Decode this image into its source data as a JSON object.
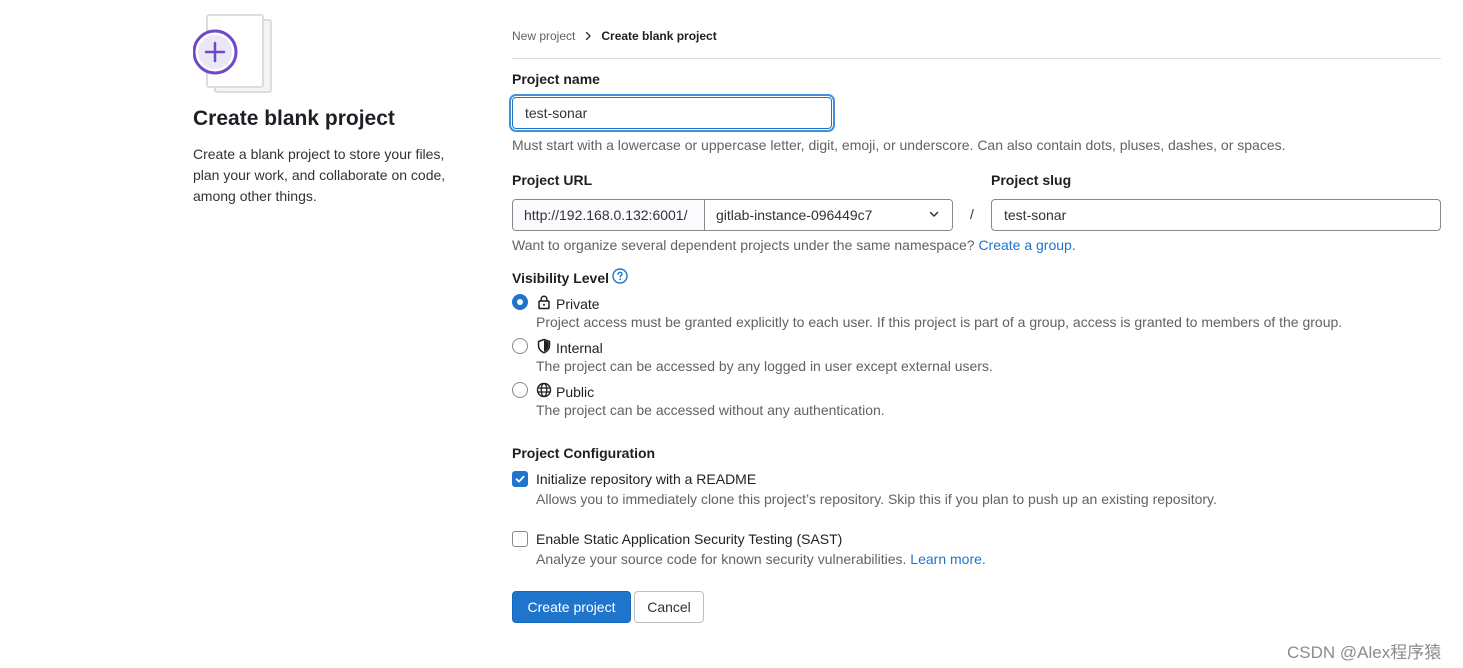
{
  "intro": {
    "title": "Create blank project",
    "description": "Create a blank project to store your files, plan your work, and collaborate on code, among other things."
  },
  "breadcrumb": {
    "parent": "New project",
    "current": "Create blank project"
  },
  "project_name": {
    "label": "Project name",
    "value": "test-sonar",
    "help": "Must start with a lowercase or uppercase letter, digit, emoji, or underscore. Can also contain dots, pluses, dashes, or spaces."
  },
  "project_url": {
    "label": "Project URL",
    "prefix": "http://192.168.0.132:6001/",
    "namespace": "gitlab-instance-096449c7",
    "separator": "/",
    "help": "Want to organize several dependent projects under the same namespace?",
    "help_link": "Create a group."
  },
  "project_slug": {
    "label": "Project slug",
    "value": "test-sonar"
  },
  "visibility": {
    "label": "Visibility Level",
    "selected": "Private",
    "options": [
      {
        "name": "Private",
        "icon": "lock-icon",
        "description": "Project access must be granted explicitly to each user. If this project is part of a group, access is granted to members of the group."
      },
      {
        "name": "Internal",
        "icon": "shield-icon",
        "description": "The project can be accessed by any logged in user except external users."
      },
      {
        "name": "Public",
        "icon": "earth-icon",
        "description": "The project can be accessed without any authentication."
      }
    ]
  },
  "configuration": {
    "label": "Project Configuration",
    "readme": {
      "checked": true,
      "label": "Initialize repository with a README",
      "description": "Allows you to immediately clone this project’s repository. Skip this if you plan to push up an existing repository."
    },
    "sast": {
      "checked": false,
      "label": "Enable Static Application Security Testing (SAST)",
      "description": "Analyze your source code for known security vulnerabilities.",
      "link": "Learn more."
    }
  },
  "actions": {
    "create": "Create project",
    "cancel": "Cancel"
  },
  "watermark": "CSDN @Alex程序猿",
  "colors": {
    "accent": "#1f75cb",
    "illustration_purple": "#6e49cb"
  }
}
